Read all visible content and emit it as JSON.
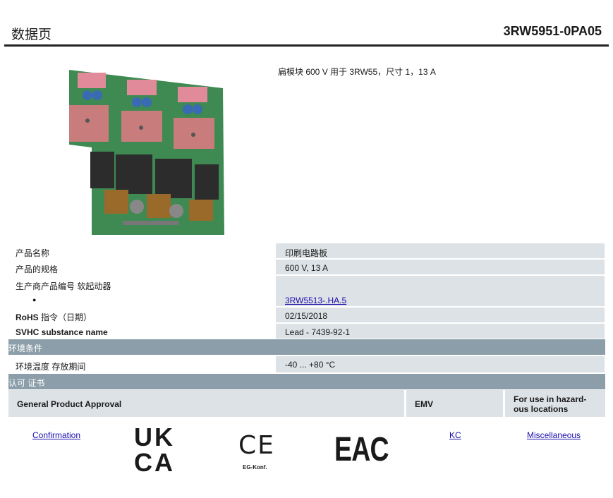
{
  "header": {
    "title": "数据页",
    "code": "3RW5951-0PA05"
  },
  "product": {
    "description": "扁模块 600 V 用于 3RW55，尺寸 1，13 A"
  },
  "specs": {
    "name_label": "产品名称",
    "name_value": "印刷电路板",
    "spec_label": "产品的规格",
    "spec_value": "600 V, 13 A",
    "mfr_label": "生产商产品编号 软起动器",
    "mfr_bullet": "●",
    "mfr_value": "3RW5513-.HA.5",
    "rohs_label_bold": "RoHS",
    "rohs_label_rest": " 指令（日期）",
    "rohs_value": "02/15/2018",
    "svhc_label": "SVHC substance name",
    "svhc_value": "Lead - 7439-92-1"
  },
  "environment": {
    "title": "环境条件",
    "temp_label": "环境温度 存放期间",
    "temp_value": "-40 ... +80 °C"
  },
  "certs": {
    "title": "认可 证书",
    "col_general": "General Product Approval",
    "col_emv": "EMV",
    "col_hazard_1": "For use in hazard-",
    "col_hazard_2": "ous locations",
    "link_confirmation": "Confirmation",
    "link_kc": "KC",
    "link_misc": "Miscellaneous",
    "ukca_top": "UK",
    "ukca_bottom": "CA",
    "ce_mark": "CE",
    "ce_sub": "EG-Konf.",
    "eac_mark": "EAC"
  },
  "colors": {
    "row_bg": "#dde2e6",
    "section_bg": "#8c9ea9",
    "pcb_green": "#3e8a52",
    "link": "#1a0dab"
  }
}
